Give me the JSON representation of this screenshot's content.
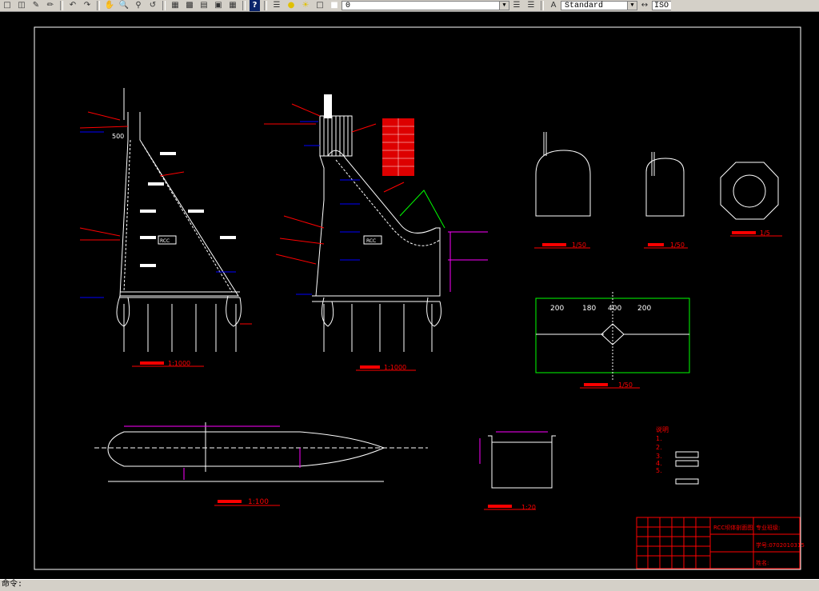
{
  "toolbar": {
    "layer_value": "0",
    "text_style": "Standard",
    "dim_style": "ISO"
  },
  "icons": [
    "new-icon",
    "open-icon",
    "pencil-icon",
    "paint-icon",
    "undo-icon",
    "redo-icon",
    "pan-icon",
    "zoom-realtime-icon",
    "zoom-window-icon",
    "zoom-previous-icon",
    "properties-icon",
    "design-center-icon",
    "tool-palettes-icon",
    "sheet-set-icon",
    "calculator-icon",
    "help-icon",
    "layer-manager-icon",
    "lightbulb-icon",
    "sun-icon",
    "lock-icon",
    "color-square-icon",
    "layer-previous-icon",
    "layer-states-icon",
    "text-style-icon"
  ],
  "drawing": {
    "rcc1": "RCC",
    "rcc2": "RCC",
    "dim_500": "500",
    "dim_200": "200",
    "dim_180": "180",
    "dim_400": "400",
    "dim_200b": "200",
    "scale_1_1000a": "1:1000",
    "scale_1_1000b": "1:1000",
    "scale_1_50a": "1/50",
    "scale_1_50b": "1/50",
    "scale_1_5": "1/5",
    "scale_1_50c": "1/50",
    "scale_1_100": "1:100",
    "scale_1_20": "1:20",
    "notes_heading": "说明",
    "notes_items": [
      "1.",
      "2.",
      "3.",
      "4.",
      "5."
    ],
    "title_block": {
      "drawing_name": "RCC坝体剖面图",
      "major": "专业班级:",
      "student_no": "学号:0702010315",
      "name": "姓名:"
    }
  },
  "status": {
    "prompt": "命令:"
  }
}
